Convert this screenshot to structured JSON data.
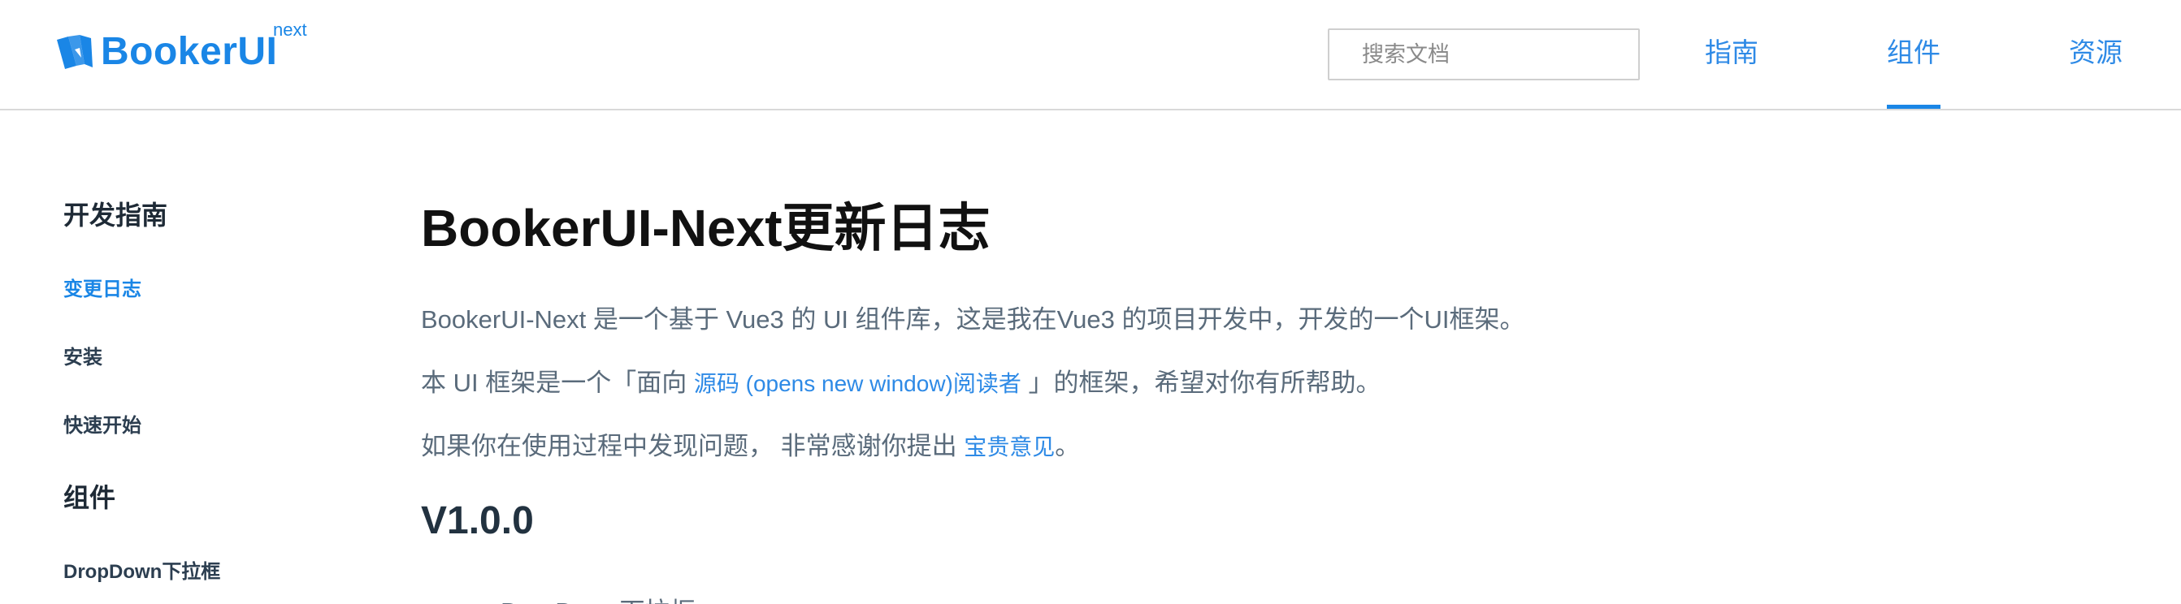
{
  "brand": {
    "name": "BookerUI",
    "superscript": "next",
    "color": "#1a86e6"
  },
  "header": {
    "search_placeholder": "搜索文档",
    "nav": [
      {
        "label": "指南",
        "active": false
      },
      {
        "label": "组件",
        "active": true
      },
      {
        "label": "资源",
        "active": false
      }
    ]
  },
  "sidebar": {
    "groups": [
      {
        "title": "开发指南",
        "items": [
          {
            "label": "变更日志",
            "active": true
          },
          {
            "label": "安装",
            "active": false
          },
          {
            "label": "快速开始",
            "active": false
          }
        ]
      },
      {
        "title": "组件",
        "items": [
          {
            "label": "DropDown下拉框",
            "active": false
          }
        ]
      }
    ]
  },
  "main": {
    "title": "BookerUI-Next更新日志",
    "paragraph1": "BookerUI-Next 是一个基于 Vue3 的 UI 组件库，这是我在Vue3 的项目开发中，开发的一个UI框架。",
    "paragraph2": {
      "before": "本 UI 框架是一个「面向 ",
      "link": "源码 (opens new window)阅读者",
      "after": " 」的框架，希望对你有所帮助。"
    },
    "paragraph3": {
      "before": "如果你在使用过程中发现问题， 非常感谢你提出 ",
      "link": "宝贵意见",
      "after": "。"
    },
    "version_heading": "V1.0.0",
    "version_first_item": "DropDown下拉框"
  }
}
